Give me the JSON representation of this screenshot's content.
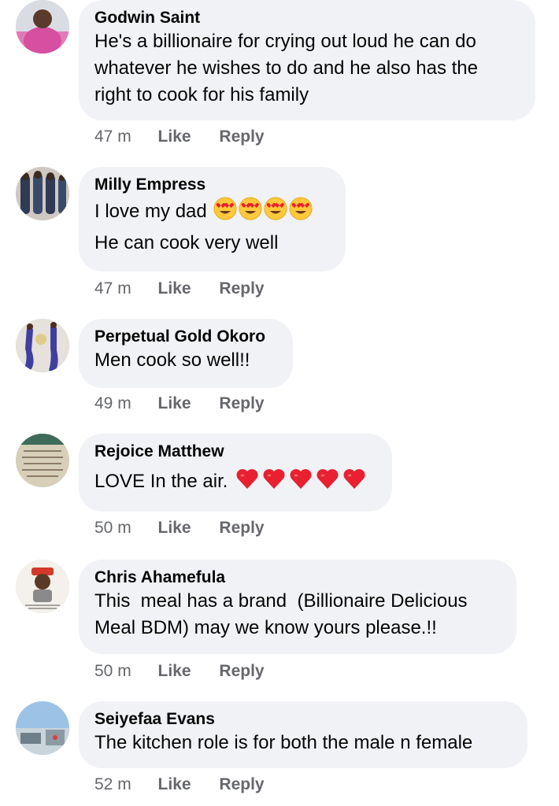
{
  "comments": [
    {
      "author": "Godwin Saint",
      "lines": [
        "He's a billionaire for crying out loud he can do",
        "whatever he wishes to do and he also has the",
        "right to cook for his family"
      ],
      "time": "47 m",
      "like": "Like",
      "reply": "Reply"
    },
    {
      "author": "Milly Empress",
      "lines": [
        "I love my dad",
        "He can cook very well"
      ],
      "emoji": "smiling-face-with-heart-eyes x4",
      "time": "47 m",
      "like": "Like",
      "reply": "Reply"
    },
    {
      "author": "Perpetual Gold Okoro",
      "lines": [
        "Men cook so well!!"
      ],
      "time": "49 m",
      "like": "Like",
      "reply": "Reply"
    },
    {
      "author": "Rejoice Matthew",
      "lines": [
        "LOVE In the air."
      ],
      "emoji": "red-heart x5",
      "time": "50 m",
      "like": "Like",
      "reply": "Reply"
    },
    {
      "author": "Chris Ahamefula",
      "lines": [
        "This  meal has a brand  (Billionaire Delicious",
        "Meal BDM) may we know yours please.!!"
      ],
      "time": "50 m",
      "like": "Like",
      "reply": "Reply"
    },
    {
      "author": "Seiyefaa Evans",
      "lines": [
        "The kitchen role is for both the male n female"
      ],
      "time": "52 m",
      "like": "Like",
      "reply": "Reply"
    }
  ],
  "colors": {
    "bubble": "#f0f2f5",
    "meta_text": "#65676b",
    "body_text": "#050505",
    "heart_red": "#e8202f",
    "emoji_yellow": "#ffc93b"
  }
}
